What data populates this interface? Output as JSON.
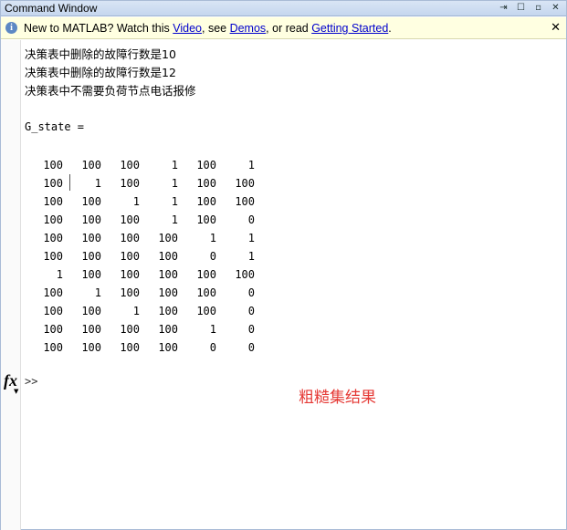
{
  "window": {
    "title": "Command Window",
    "icons": [
      "undock-icon",
      "maximize-icon",
      "minimize-icon",
      "close-icon"
    ]
  },
  "infobar": {
    "prefix": "New to MATLAB? Watch this ",
    "video_link": "Video",
    "sep1": ", see ",
    "demos_link": "Demos",
    "sep2": ", or read ",
    "getting_started_link": "Getting Started",
    "suffix": ".",
    "close_label": "✕"
  },
  "output": {
    "messages": [
      "决策表中删除的故障行数是10",
      "决策表中删除的故障行数是12",
      "决策表中不需要负荷节点电话报修"
    ],
    "variable_line": "G_state ="
  },
  "matrix": [
    [
      "100",
      "100",
      "100",
      "1",
      "100",
      "1"
    ],
    [
      "100",
      "1",
      "100",
      "1",
      "100",
      "100"
    ],
    [
      "100",
      "100",
      "1",
      "1",
      "100",
      "100"
    ],
    [
      "100",
      "100",
      "100",
      "1",
      "100",
      "0"
    ],
    [
      "100",
      "100",
      "100",
      "100",
      "1",
      "1"
    ],
    [
      "100",
      "100",
      "100",
      "100",
      "0",
      "1"
    ],
    [
      "1",
      "100",
      "100",
      "100",
      "100",
      "100"
    ],
    [
      "100",
      "1",
      "100",
      "100",
      "100",
      "0"
    ],
    [
      "100",
      "100",
      "1",
      "100",
      "100",
      "0"
    ],
    [
      "100",
      "100",
      "100",
      "100",
      "1",
      "0"
    ],
    [
      "100",
      "100",
      "100",
      "100",
      "0",
      "0"
    ]
  ],
  "prompt": {
    "fx_label": "fx",
    "symbol": ">>"
  },
  "annotation": "粗糙集结果"
}
